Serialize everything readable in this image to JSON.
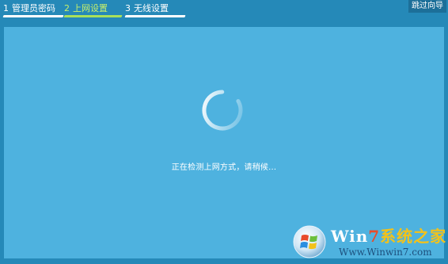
{
  "steps": [
    {
      "number": "1",
      "label": "管理员密码",
      "active": false
    },
    {
      "number": "2",
      "label": "上网设置",
      "active": true
    },
    {
      "number": "3",
      "label": "无线设置",
      "active": false
    }
  ],
  "skip_label": "跳过向导",
  "status": "正在检测上网方式，请稍候...",
  "watermark": {
    "title_part1": "Win",
    "title_part2": "7",
    "title_part3": "系统之家",
    "url": "Www.Winwin7.com"
  },
  "colors": {
    "background": "#2589b8",
    "panel": "#4eb2df",
    "active_step": "#c8f06a"
  }
}
